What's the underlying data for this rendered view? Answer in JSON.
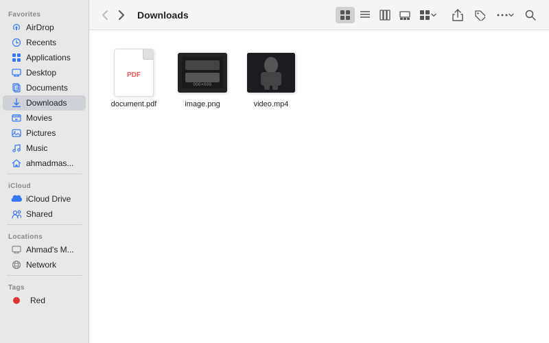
{
  "sidebar": {
    "sections": [
      {
        "label": "Favorites",
        "items": [
          {
            "id": "airdrop",
            "name": "AirDrop",
            "icon": "airdrop"
          },
          {
            "id": "recents",
            "name": "Recents",
            "icon": "recents"
          },
          {
            "id": "applications",
            "name": "Applications",
            "icon": "applications"
          },
          {
            "id": "desktop",
            "name": "Desktop",
            "icon": "desktop"
          },
          {
            "id": "documents",
            "name": "Documents",
            "icon": "documents"
          },
          {
            "id": "downloads",
            "name": "Downloads",
            "icon": "downloads",
            "active": true
          },
          {
            "id": "movies",
            "name": "Movies",
            "icon": "movies"
          },
          {
            "id": "pictures",
            "name": "Pictures",
            "icon": "pictures"
          },
          {
            "id": "music",
            "name": "Music",
            "icon": "music"
          },
          {
            "id": "home",
            "name": "ahmadmas...",
            "icon": "home"
          }
        ]
      },
      {
        "label": "iCloud",
        "items": [
          {
            "id": "icloud-drive",
            "name": "iCloud Drive",
            "icon": "icloud"
          },
          {
            "id": "shared",
            "name": "Shared",
            "icon": "shared"
          }
        ]
      },
      {
        "label": "Locations",
        "items": [
          {
            "id": "ahmads-mac",
            "name": "Ahmad's M...",
            "icon": "computer"
          },
          {
            "id": "network",
            "name": "Network",
            "icon": "network"
          }
        ]
      },
      {
        "label": "Tags",
        "items": [
          {
            "id": "red-tag",
            "name": "Red",
            "icon": "red-tag"
          }
        ]
      }
    ]
  },
  "toolbar": {
    "back_label": "‹",
    "forward_label": "›",
    "title": "Downloads",
    "view_icons": [
      "icon-grid",
      "icon-list",
      "icon-columns",
      "icon-gallery"
    ],
    "action_group_label": "⋯",
    "search_icon": "search"
  },
  "files": [
    {
      "id": "document-pdf",
      "name": "document.pdf",
      "type": "pdf"
    },
    {
      "id": "image-png",
      "name": "image.png",
      "type": "png",
      "thumb_label": "000×000"
    },
    {
      "id": "video-mp4",
      "name": "video.mp4",
      "type": "video"
    }
  ]
}
